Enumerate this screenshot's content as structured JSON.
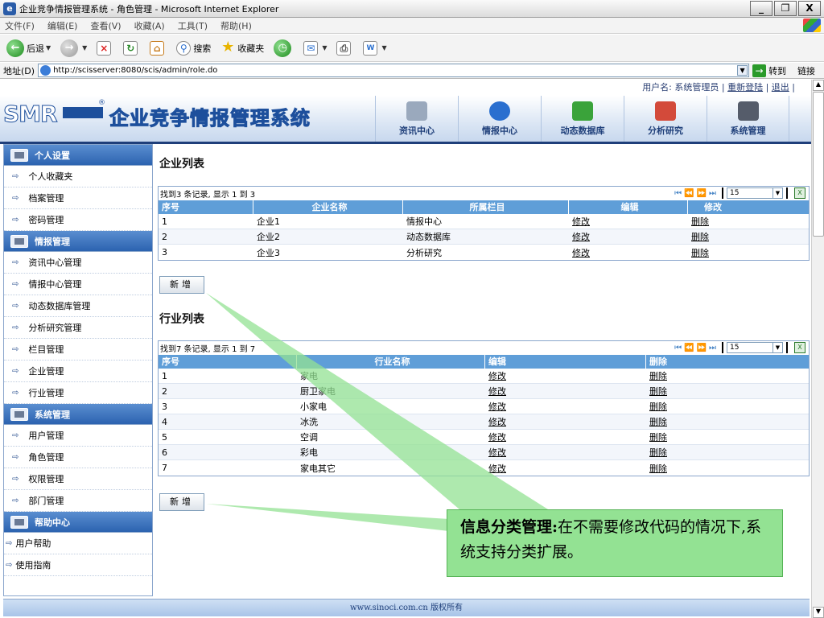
{
  "window": {
    "title": "企业竞争情报管理系统 - 角色管理 - Microsoft Internet Explorer",
    "min": "_",
    "max": "❐",
    "close": "X"
  },
  "menu": [
    "文件(F)",
    "编辑(E)",
    "查看(V)",
    "收藏(A)",
    "工具(T)",
    "帮助(H)"
  ],
  "toolbar": {
    "back": "后退",
    "search": "搜索",
    "favorites": "收藏夹"
  },
  "address": {
    "label": "地址(D)",
    "url": "http://scisserver:8080/scis/admin/role.do",
    "go": "转到",
    "links": "链接"
  },
  "userbar": {
    "user": "用户名: 系统管理员 | ",
    "relogin": "重新登陆",
    "sep": " | ",
    "logout": "退出",
    "end": " |"
  },
  "brand": {
    "logo": "SMR",
    "reg": "®",
    "system_name": "企业竞争情报管理系统"
  },
  "nav": [
    {
      "label": "资讯中心",
      "icon": "news-icon",
      "color": "#9aa9bd"
    },
    {
      "label": "情报中心",
      "icon": "globe-icon",
      "color": "#2a6fcf"
    },
    {
      "label": "动态数据库",
      "icon": "database-icon",
      "color": "#3aa33a"
    },
    {
      "label": "分析研究",
      "icon": "chart-icon",
      "color": "#d34a3a"
    },
    {
      "label": "系统管理",
      "icon": "tools-icon",
      "color": "#555c6a"
    }
  ],
  "sidebar": {
    "groups": [
      {
        "title": "个人设置",
        "items": [
          "个人收藏夹",
          "档案管理",
          "密码管理"
        ]
      },
      {
        "title": "情报管理",
        "items": [
          "资讯中心管理",
          "情报中心管理",
          "动态数据库管理",
          "分析研究管理",
          "栏目管理",
          "企业管理",
          "行业管理"
        ]
      },
      {
        "title": "系统管理",
        "items": [
          "用户管理",
          "角色管理",
          "权限管理",
          "部门管理"
        ]
      },
      {
        "title": "帮助中心",
        "items": [
          "用户帮助",
          "使用指南"
        ]
      }
    ]
  },
  "company": {
    "title": "企业列表",
    "info": "找到3 条记录, 显示 1 到 3",
    "page_size": "15",
    "headers": [
      "序号",
      "企业名称",
      "所属栏目",
      "编辑",
      "修改"
    ],
    "rows": [
      [
        "1",
        "企业1",
        "情报中心",
        "修改",
        "删除"
      ],
      [
        "2",
        "企业2",
        "动态数据库",
        "修改",
        "删除"
      ],
      [
        "3",
        "企业3",
        "分析研究",
        "修改",
        "删除"
      ]
    ],
    "add": "新增"
  },
  "industry": {
    "title": "行业列表",
    "info": "找到7 条记录, 显示 1 到 7",
    "page_size": "15",
    "headers": [
      "序号",
      "行业名称",
      "编辑",
      "删除"
    ],
    "rows": [
      [
        "1",
        "家电",
        "修改",
        "删除"
      ],
      [
        "2",
        "厨卫家电",
        "修改",
        "删除"
      ],
      [
        "3",
        "小家电",
        "修改",
        "删除"
      ],
      [
        "4",
        "冰洗",
        "修改",
        "删除"
      ],
      [
        "5",
        "空调",
        "修改",
        "删除"
      ],
      [
        "6",
        "彩电",
        "修改",
        "删除"
      ],
      [
        "7",
        "家电其它",
        "修改",
        "删除"
      ]
    ],
    "add": "新增"
  },
  "footer": "www.sinoci.com.cn 版权所有",
  "callout": {
    "bold": "信息分类管理:",
    "text": "在不需要修改代码的情况下,系统支持分类扩展。"
  },
  "colors": {
    "header_blue": "#1f3f7a",
    "table_head": "#5f9ed8",
    "callout_green": "#93e293"
  }
}
